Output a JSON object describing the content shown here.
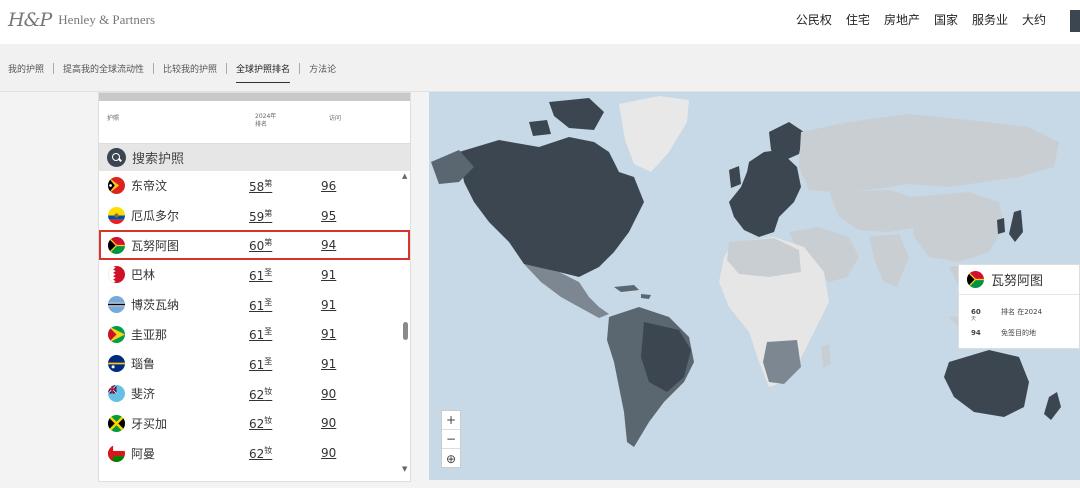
{
  "header": {
    "logo_mark": "H&P",
    "logo_text": "Henley & Partners",
    "nav": [
      "公民权",
      "住宅",
      "房地产",
      "国家",
      "服务业",
      "大约"
    ]
  },
  "subnav": {
    "items": [
      "我的护照",
      "提高我的全球流动性",
      "比较我的护照",
      "全球护照排名",
      "方法论"
    ],
    "active_index": 3
  },
  "table": {
    "col_passport": "护照",
    "col_rank_line1": "2024年",
    "col_rank_line2": "排名",
    "col_visa": "访问",
    "search_label": "搜索护照",
    "rows": [
      {
        "name": "东帝汶",
        "rank": "58",
        "suffix": "第",
        "visa": "96",
        "flag": "timor-leste"
      },
      {
        "name": "厄瓜多尔",
        "rank": "59",
        "suffix": "第",
        "visa": "95",
        "flag": "ecuador"
      },
      {
        "name": "瓦努阿图",
        "rank": "60",
        "suffix": "第",
        "visa": "94",
        "flag": "vanuatu",
        "highlighted": true
      },
      {
        "name": "巴林",
        "rank": "61",
        "suffix": "圣",
        "visa": "91",
        "flag": "bahrain"
      },
      {
        "name": "博茨瓦纳",
        "rank": "61",
        "suffix": "圣",
        "visa": "91",
        "flag": "botswana"
      },
      {
        "name": "圭亚那",
        "rank": "61",
        "suffix": "圣",
        "visa": "91",
        "flag": "guyana"
      },
      {
        "name": "瑙鲁",
        "rank": "61",
        "suffix": "圣",
        "visa": "91",
        "flag": "nauru"
      },
      {
        "name": "斐济",
        "rank": "62",
        "suffix": "钕",
        "visa": "90",
        "flag": "fiji"
      },
      {
        "name": "牙买加",
        "rank": "62",
        "suffix": "钕",
        "visa": "90",
        "flag": "jamaica"
      },
      {
        "name": "阿曼",
        "rank": "62",
        "suffix": "钕",
        "visa": "90",
        "flag": "oman"
      }
    ]
  },
  "tooltip": {
    "country": "瓦努阿图",
    "rank_value": "60",
    "rank_sub": "天",
    "rank_label": "排名 在2024",
    "visa_value": "94",
    "visa_label": "免签目的地"
  },
  "map_controls": {
    "zoom_in": "+",
    "zoom_out": "−",
    "globe": "⊕"
  },
  "colors": {
    "dark": "#3b4650",
    "mid": "#7c8791",
    "light": "#c9ced3",
    "ocean": "#c7d8e6",
    "highlight": "#d8352a"
  }
}
